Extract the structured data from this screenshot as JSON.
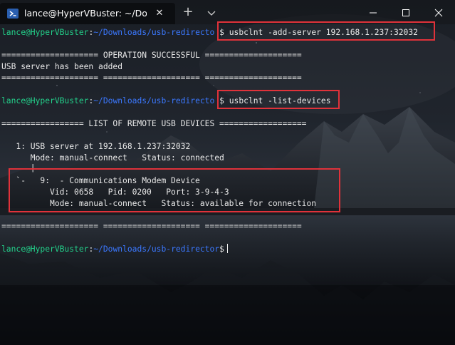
{
  "window": {
    "tab_title": "lance@HyperVBuster: ~/Downlc",
    "tab_close": "✕",
    "new_tab": "+",
    "icons": {
      "tab": "powershell-icon",
      "dropdown": "chevron-down-icon",
      "minimize": "minimize-icon",
      "maximize": "maximize-icon",
      "close": "close-icon"
    }
  },
  "terminal": {
    "prompt1": {
      "user": "lance@HyperVBuster",
      "sep": ":",
      "path": "~/Downloads/usb-redirecto",
      "command": "$ usbclnt -add-server 192.168.1.237:32032"
    },
    "sep_line_1": "==================== OPERATION SUCCESSFUL ====================",
    "result_line": "USB server has been added",
    "sep_line_2": "==================== ==================== ====================",
    "prompt2": {
      "user": "lance@HyperVBuster",
      "sep": ":",
      "path": "~/Downloads/usb-redirecto",
      "command": "$ usbclnt -list-devices"
    },
    "list_header": "================= LIST OF REMOTE USB DEVICES ==================",
    "server_line": "   1: USB server at 192.168.1.237:32032",
    "server_mode": "      Mode: manual-connect   Status: connected",
    "tree_pipe": "      |",
    "device_line": "   `-   9:  - Communications Modem Device",
    "device_ids": "          Vid: 0658   Pid: 0200   Port: 3-9-4-3",
    "device_mode": "          Mode: manual-connect   Status: available for connection",
    "sep_line_3": "==================== ==================== ====================",
    "prompt3": {
      "user": "lance@HyperVBuster",
      "sep": ":",
      "path": "~/Downloads/usb-redirector",
      "command": "$"
    }
  },
  "colors": {
    "user": "#23d18b",
    "path": "#3b78ff",
    "highlight": "#e0323a"
  }
}
